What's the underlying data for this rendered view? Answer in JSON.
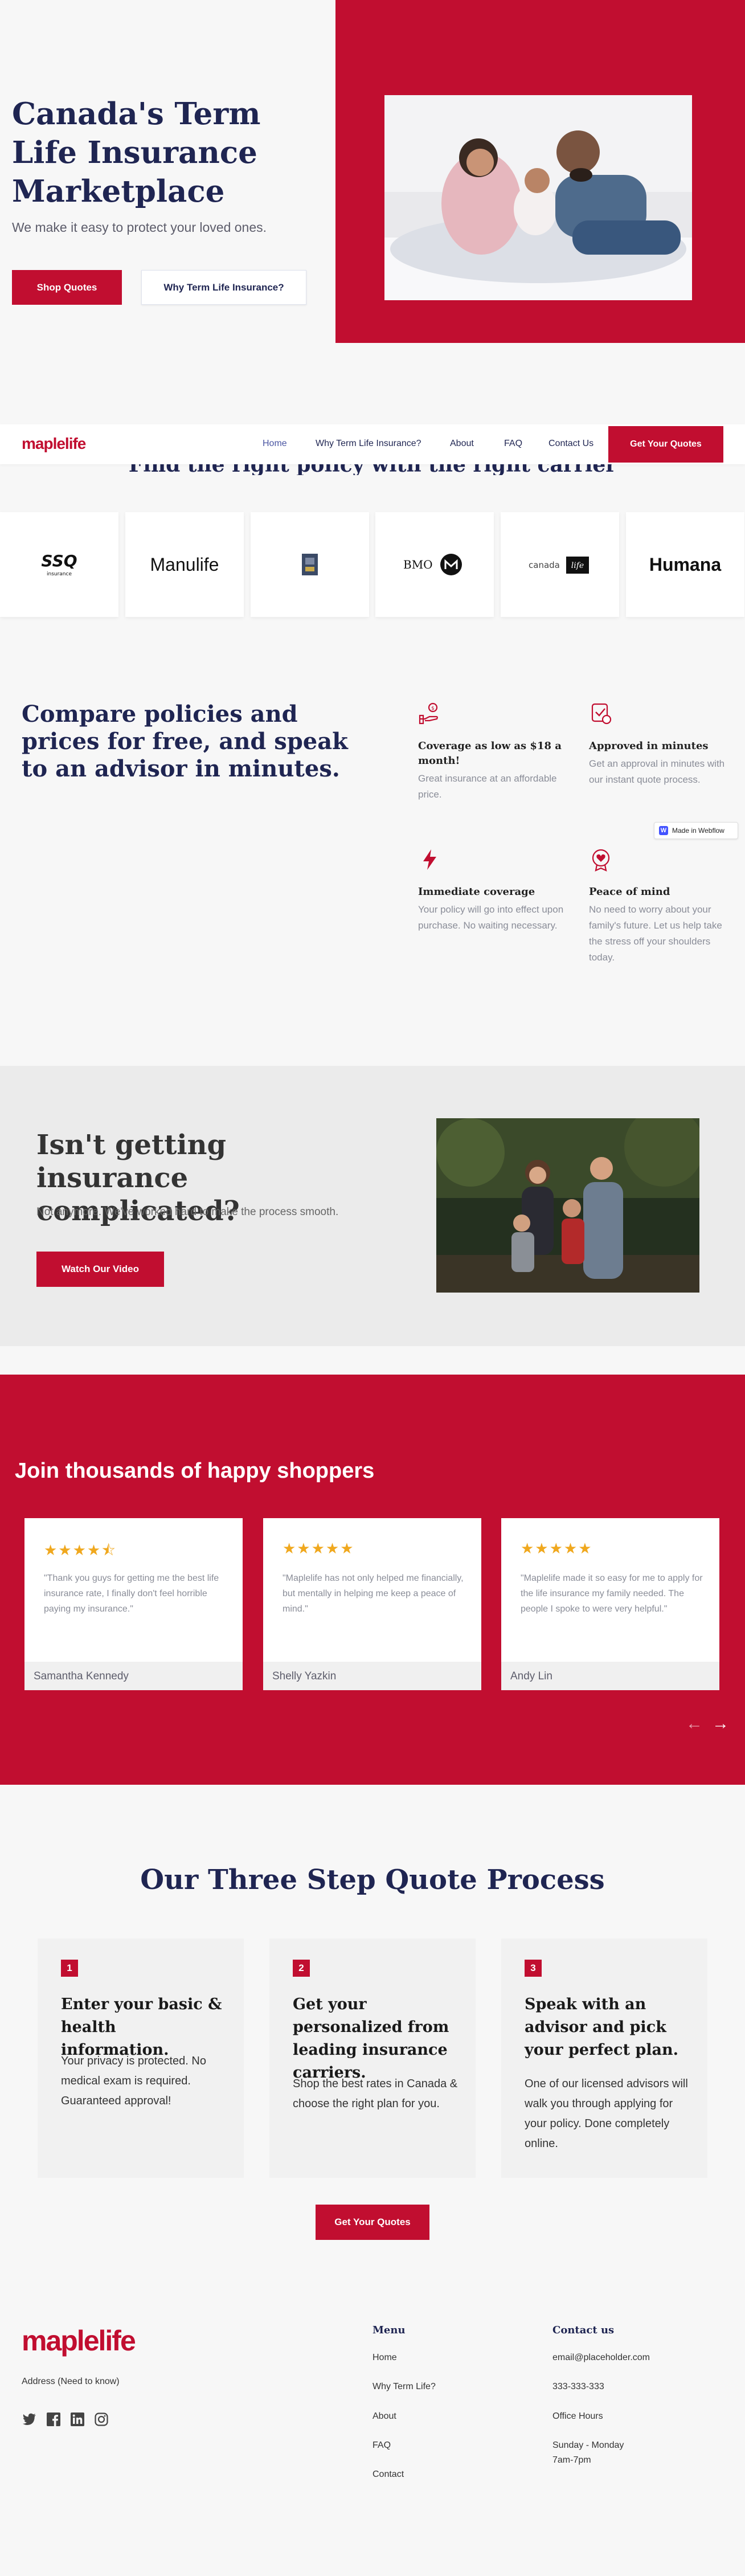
{
  "hero": {
    "title": "Canada's Term Life Insurance Marketplace",
    "subtitle": "We make it easy to protect your loved ones.",
    "btn_quotes": "Shop Quotes",
    "btn_why": "Why Term Life Insurance?"
  },
  "nav": {
    "logo": "maplelife",
    "links": [
      "Home",
      "Why Term Life Insurance?",
      "About",
      "FAQ",
      "Contact Us"
    ],
    "cta": "Get Your Quotes"
  },
  "carriers": {
    "title": "Find the right policy with the right carrier",
    "logos": [
      "SSQ insurance",
      "Manulife",
      "RBC",
      "BMO",
      "canada life",
      "Humana"
    ]
  },
  "compare": {
    "title": "Compare policies and prices for free, and speak to an advisor in minutes.",
    "features": [
      {
        "icon": "hand-coin-icon",
        "title": "Coverage as low as $18 a month!",
        "desc": "Great insurance at an affordable price."
      },
      {
        "icon": "approval-badge-icon",
        "title": "Approved in minutes",
        "desc": "Get an approval in minutes with our instant quote process."
      },
      {
        "icon": "lightning-icon",
        "title": "Immediate coverage",
        "desc": "Your policy will go into effect upon purchase. No waiting necessary."
      },
      {
        "icon": "heart-badge-icon",
        "title": "Peace of mind",
        "desc": "No need to worry about your family's future. Let us help take the stress off your shoulders today."
      }
    ],
    "badge": "Made in Webflow"
  },
  "complicated": {
    "title": "Isn't getting insurance complicated?",
    "subtitle": "Not anymore. We've worked hard to make the process smooth.",
    "btn": "Watch Our Video"
  },
  "testimonials": {
    "title": "Join thousands of happy shoppers",
    "cards": [
      {
        "stars": "★★★★⯪",
        "quote": "\"Thank you guys for getting me the best life insurance rate, I finally don't feel horrible paying my insurance.\"",
        "name": "Samantha Kennedy"
      },
      {
        "stars": "★★★★★",
        "quote": "\"Maplelife has not only helped me financially, but mentally in helping me keep a peace of mind.\"",
        "name": "Shelly Yazkin"
      },
      {
        "stars": "★★★★★",
        "quote": "\"Maplelife made it so easy for me to apply for the life insurance my family needed. The people I spoke to were very helpful.\"",
        "name": "Andy Lin"
      }
    ],
    "prev": "←",
    "next": "→"
  },
  "steps": {
    "title": "Our Three Step Quote Process",
    "items": [
      {
        "num": "1",
        "title": "Enter your basic & health information.",
        "desc": "Your privacy is protected. No medical exam is required. Guaranteed approval!"
      },
      {
        "num": "2",
        "title": "Get your personalized from leading insurance carriers.",
        "desc": "Shop the best rates in Canada & choose the right plan for you."
      },
      {
        "num": "3",
        "title": "Speak with an advisor and pick your perfect plan.",
        "desc": "One of our licensed advisors will walk you through applying for your policy. Done completely online."
      }
    ],
    "btn": "Get Your Quotes"
  },
  "footer": {
    "logo": "maplelife",
    "address": "Address (Need to know)",
    "socials": [
      "twitter-icon",
      "facebook-icon",
      "linkedin-icon",
      "instagram-icon"
    ],
    "menu_title": "Menu",
    "menu": [
      "Home",
      "Why Term Life?",
      "About",
      "FAQ",
      "Contact"
    ],
    "contact_title": "Contact us",
    "email": "email@placeholder.com",
    "phone": "333-333-333",
    "hours_label": "Office Hours",
    "hours_days": "Sunday - Monday",
    "hours_time": "7am-7pm"
  },
  "colors": {
    "brand_red": "#c10e30",
    "navy": "#1f2552",
    "star": "#f0a81e"
  }
}
